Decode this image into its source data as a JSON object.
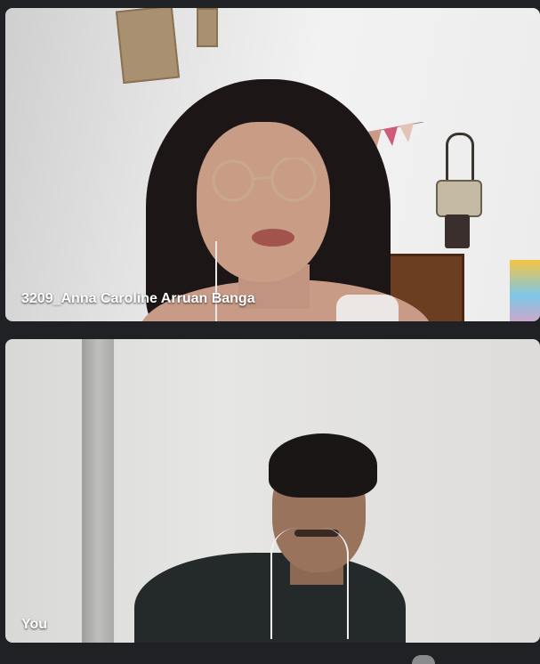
{
  "participants": [
    {
      "name": "3209_Anna Caroline Arruan Banga"
    },
    {
      "name": "You"
    }
  ],
  "colors": {
    "background": "#202124",
    "label_text": "#ffffff"
  }
}
